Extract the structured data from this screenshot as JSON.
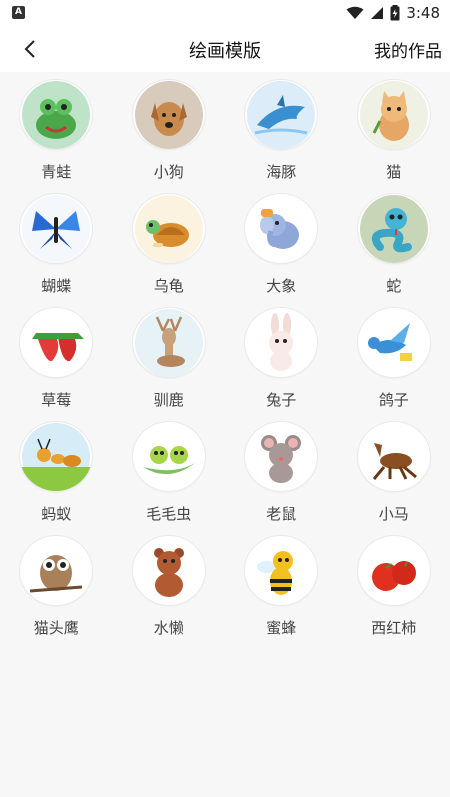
{
  "status_bar": {
    "time": "3:48",
    "app_icon_letter": "A"
  },
  "header": {
    "title": "绘画模版",
    "right_action": "我的作品"
  },
  "templates": [
    {
      "label": "青蛙",
      "icon": "frog-icon",
      "bg": "#bfe3c9"
    },
    {
      "label": "小狗",
      "icon": "dog-icon",
      "bg": "#d9cbbb"
    },
    {
      "label": "海豚",
      "icon": "dolphin-icon",
      "bg": "#dcecf8"
    },
    {
      "label": "猫",
      "icon": "cat-icon",
      "bg": "#eef1e4"
    },
    {
      "label": "蝴蝶",
      "icon": "butterfly-icon",
      "bg": "#f4f7fb"
    },
    {
      "label": "乌龟",
      "icon": "turtle-icon",
      "bg": "#fbf3df"
    },
    {
      "label": "大象",
      "icon": "elephant-icon",
      "bg": "#ffffff"
    },
    {
      "label": "蛇",
      "icon": "snake-icon",
      "bg": "#c8d6b8"
    },
    {
      "label": "草莓",
      "icon": "strawberry-icon",
      "bg": "#ffffff"
    },
    {
      "label": "驯鹿",
      "icon": "deer-icon",
      "bg": "#e7f2f6"
    },
    {
      "label": "兔子",
      "icon": "rabbit-icon",
      "bg": "#ffffff"
    },
    {
      "label": "鸽子",
      "icon": "pigeon-icon",
      "bg": "#ffffff"
    },
    {
      "label": "蚂蚁",
      "icon": "ant-icon",
      "bg": "#d6ecf7"
    },
    {
      "label": "毛毛虫",
      "icon": "caterpillar-icon",
      "bg": "#ffffff"
    },
    {
      "label": "老鼠",
      "icon": "mouse-icon",
      "bg": "#ffffff"
    },
    {
      "label": "小马",
      "icon": "horse-icon",
      "bg": "#ffffff"
    },
    {
      "label": "猫头鹰",
      "icon": "owl-icon",
      "bg": "#ffffff"
    },
    {
      "label": "水懒",
      "icon": "otter-icon",
      "bg": "#ffffff"
    },
    {
      "label": "蜜蜂",
      "icon": "bee-icon",
      "bg": "#ffffff"
    },
    {
      "label": "西红柿",
      "icon": "tomato-icon",
      "bg": "#ffffff"
    }
  ]
}
